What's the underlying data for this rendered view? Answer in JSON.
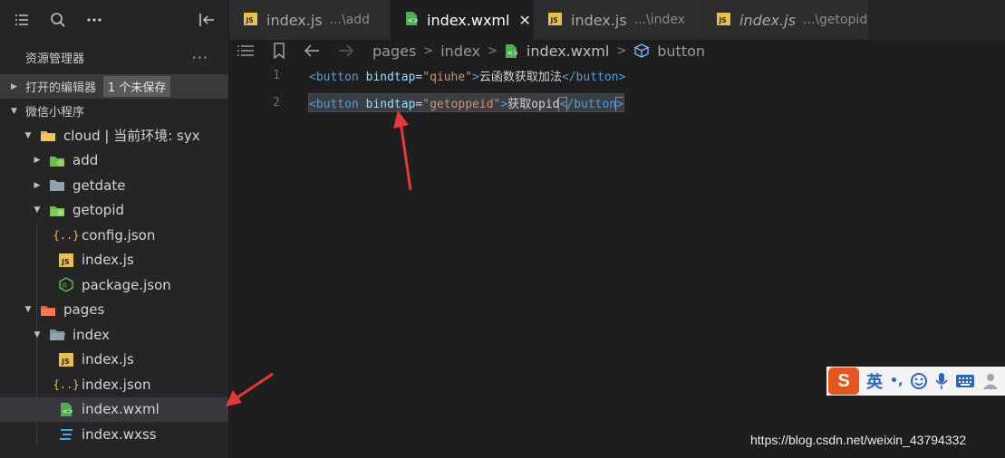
{
  "sidebar": {
    "toolbar_icons": [
      "list-icon",
      "search-icon",
      "more-icon",
      "collapse-panel-icon"
    ],
    "title": "资源管理器",
    "title_more": "···",
    "open_editors": {
      "label": "打开的编辑器",
      "badge": "1 个未保存"
    },
    "project": {
      "label": "微信小程序"
    },
    "tree": [
      {
        "label": "cloud | 当前环境: syx",
        "icon": "folder-cloud-icon"
      },
      {
        "label": "add",
        "icon": "folder-cloud-icon"
      },
      {
        "label": "getdate",
        "icon": "folder-icon"
      },
      {
        "label": "getopid",
        "icon": "folder-cloud-icon"
      },
      {
        "label": "config.json",
        "icon": "json-icon"
      },
      {
        "label": "index.js",
        "icon": "js-icon"
      },
      {
        "label": "package.json",
        "icon": "nodejs-icon"
      },
      {
        "label": "pages",
        "icon": "folder-pages-icon"
      },
      {
        "label": "index",
        "icon": "folder-open-icon"
      },
      {
        "label": "index.js",
        "icon": "js-icon"
      },
      {
        "label": "index.json",
        "icon": "json-icon"
      },
      {
        "label": "index.wxml",
        "icon": "wxml-icon"
      },
      {
        "label": "index.wxss",
        "icon": "css-icon"
      }
    ]
  },
  "tabs": [
    {
      "name": "index.js",
      "hint": "...\\add",
      "icon": "js-icon"
    },
    {
      "name": "index.wxml",
      "hint": "",
      "icon": "wxml-icon",
      "close": "✕"
    },
    {
      "name": "index.js",
      "hint": "...\\index",
      "icon": "js-icon"
    },
    {
      "name": "index.js",
      "hint": "...\\getopid",
      "icon": "js-icon"
    }
  ],
  "breadcrumb": {
    "items": [
      "pages",
      "index",
      "index.wxml",
      "button"
    ],
    "separator": ">"
  },
  "editor": {
    "lines": [
      {
        "number": "1",
        "open_tag": "<button",
        "attr": "bindtap",
        "eq": "=",
        "value": "\"qiuhe\"",
        "open_end": ">",
        "text": "云函数获取加法",
        "close_tag": "</button>"
      },
      {
        "number": "2",
        "open_tag": "<button",
        "attr": "bindtap",
        "eq": "=",
        "value": "\"getoppeid\"",
        "open_end": ">",
        "text": "获取opid",
        "close_lt": "<",
        "close_rest": "/button",
        "close_gt": ">"
      }
    ]
  },
  "ime": {
    "logo": "S",
    "lang": "英",
    "punct": "•,",
    "items": [
      "emoji-icon",
      "microphone-icon",
      "keyboard-icon",
      "user-icon"
    ]
  },
  "watermark": "https://blog.csdn.net/weixin_43794332",
  "colors": {
    "tag": "#569cd6",
    "attribute": "#9cdcfe",
    "string": "#ce9178",
    "annotation_arrow": "#e53935"
  }
}
